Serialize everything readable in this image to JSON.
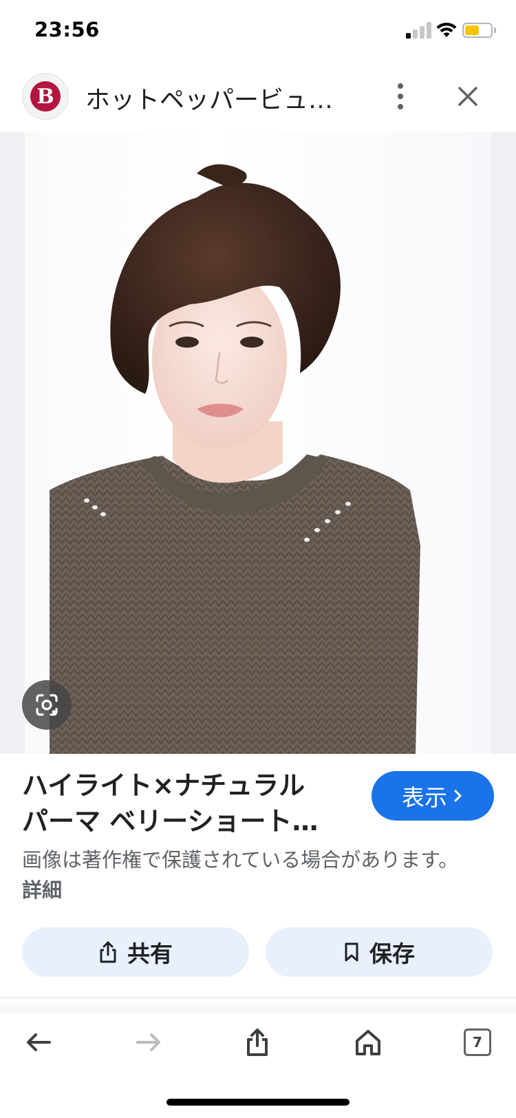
{
  "status_bar": {
    "time": "23:56",
    "signal_bars_active": 1,
    "battery_color": "#f7c600"
  },
  "header": {
    "site_logo_letter": "B",
    "site_title": "ホットペッパービュ…",
    "more_icon": "more-vert-icon",
    "close_icon": "close-icon"
  },
  "image": {
    "lens_icon": "google-lens-icon"
  },
  "result": {
    "title_line1": "ハイライト×ナチュラル",
    "title_line2": "パーマ ベリーショート…",
    "visit_label": "表示",
    "copyright_text": "画像は著作権で保護されている場合があります。",
    "details_link": "詳細",
    "share_label": "共有",
    "save_label": "保存"
  },
  "bottom_nav": {
    "tab_count": "7"
  },
  "colors": {
    "accent": "#1a73e8",
    "button_bg": "#e8f0fe",
    "brand": "#b3153f"
  }
}
